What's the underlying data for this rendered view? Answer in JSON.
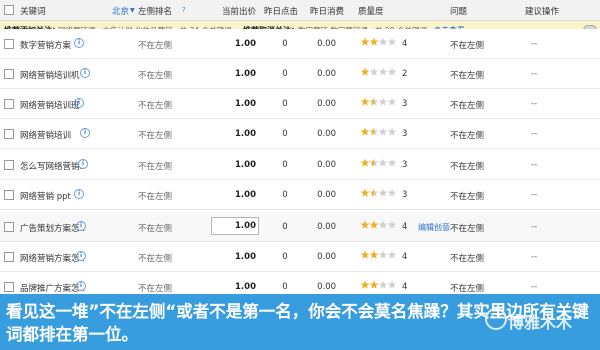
{
  "header": {
    "keyword_label": "关键词",
    "region_label": "北京",
    "region_arrow": "▼",
    "rank_label": "左侧排名",
    "rank_help": "?",
    "bid_label": "当前出价",
    "clicks_label": "昨日点击",
    "cost_label": "昨日消费",
    "quality_label": "质量度",
    "issue_label": "问题",
    "suggestion_label": "建议操作"
  },
  "suggestion_bar": {
    "add_label": "推荐添加关注：",
    "add_text": "网络营销师.. 广告计划 化妆品营销.. 共 34 个关键词",
    "cancel_label": "推荐取消关注：",
    "cancel_text": "数字营销 数字营销课.. 共 29 个关键词",
    "view_link": "点击查看",
    "collapse_glyph": "−"
  },
  "rows": [
    {
      "keyword": "数字营销方案",
      "rank": "不在左侧",
      "bid": "1.00",
      "clicks": "0",
      "cost": "0.00",
      "stars": 2,
      "quality": "4",
      "issue": "不在左侧",
      "suggestion": "--",
      "edit": ""
    },
    {
      "keyword": "网络营销培训机",
      "rank": "不在左侧",
      "bid": "1.00",
      "clicks": "0",
      "cost": "0.00",
      "stars": 1,
      "quality": "2",
      "issue": "不在左侧",
      "suggestion": "--",
      "edit": ""
    },
    {
      "keyword": "网络营销培训班",
      "rank": "不在左侧",
      "bid": "1.00",
      "clicks": "0",
      "cost": "0.00",
      "stars": 1.5,
      "quality": "3",
      "issue": "不在左侧",
      "suggestion": "--",
      "edit": ""
    },
    {
      "keyword": "网络营销培训",
      "rank": "不在左侧",
      "bid": "1.00",
      "clicks": "0",
      "cost": "0.00",
      "stars": 1.5,
      "quality": "3",
      "issue": "不在左侧",
      "suggestion": "--",
      "edit": ""
    },
    {
      "keyword": "怎么写网络营销..",
      "rank": "不在左侧",
      "bid": "1.00",
      "clicks": "0",
      "cost": "0.00",
      "stars": 1.5,
      "quality": "3",
      "issue": "不在左侧",
      "suggestion": "--",
      "edit": ""
    },
    {
      "keyword": "网络营销 ppt",
      "rank": "不在左侧",
      "bid": "1.00",
      "clicks": "0",
      "cost": "0.00",
      "stars": 1.5,
      "quality": "3",
      "issue": "不在左侧",
      "suggestion": "--",
      "edit": ""
    },
    {
      "keyword": "广告策划方案怎..",
      "rank": "不在左侧",
      "bid": "1.00",
      "clicks": "0",
      "cost": "0.00",
      "stars": 2,
      "quality": "4",
      "issue": "不在左侧",
      "suggestion": "--",
      "edit": "编辑创意"
    },
    {
      "keyword": "网络营销方案怎..",
      "rank": "不在左侧",
      "bid": "1.00",
      "clicks": "0",
      "cost": "0.00",
      "stars": 2,
      "quality": "4",
      "issue": "不在左侧",
      "suggestion": "--",
      "edit": ""
    },
    {
      "keyword": "品牌推广方案怎..",
      "rank": "不在左侧",
      "bid": "1.00",
      "clicks": "0",
      "cost": "0.00",
      "stars": 2,
      "quality": "4",
      "issue": "不在左侧",
      "suggestion": "--",
      "edit": ""
    }
  ],
  "caption": "看见这一堆”不在左侧“或者不是第一名，你会不会莫名焦躁？其实里边所有关键词都排在第一位。",
  "watermark": "博雅木木",
  "colors": {
    "star_filled": "#f2b01e",
    "star_empty": "#d0d0d0",
    "banner": "#2896dc",
    "link": "#2a6fd0"
  }
}
